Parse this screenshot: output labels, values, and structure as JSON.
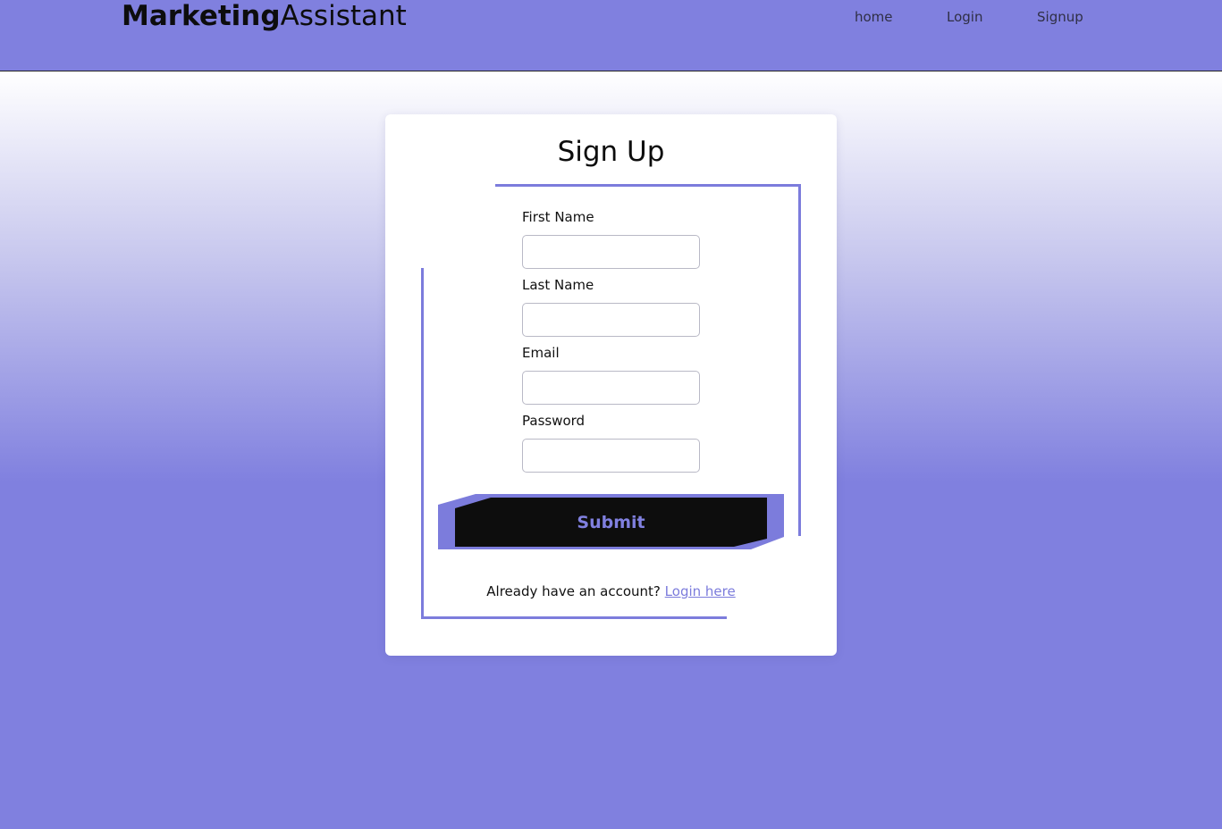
{
  "brand": {
    "bold": "Marketing",
    "light": "Assistant"
  },
  "nav": {
    "home": "home",
    "login": "Login",
    "signup": "Signup"
  },
  "form": {
    "title": "Sign Up",
    "fields": [
      {
        "label": "First Name",
        "value": "",
        "placeholder": ""
      },
      {
        "label": "Last Name",
        "value": "",
        "placeholder": ""
      },
      {
        "label": "Email",
        "value": "",
        "placeholder": ""
      },
      {
        "label": "Password",
        "value": "",
        "placeholder": ""
      }
    ],
    "submit_label": "Submit",
    "footer_text": "Already have an account?",
    "footer_link": "Login here"
  },
  "colors": {
    "accent": "#8080df",
    "frame": "#7c7cdc",
    "button_bg": "#0d0d0d",
    "text": "#0d0d0d"
  }
}
